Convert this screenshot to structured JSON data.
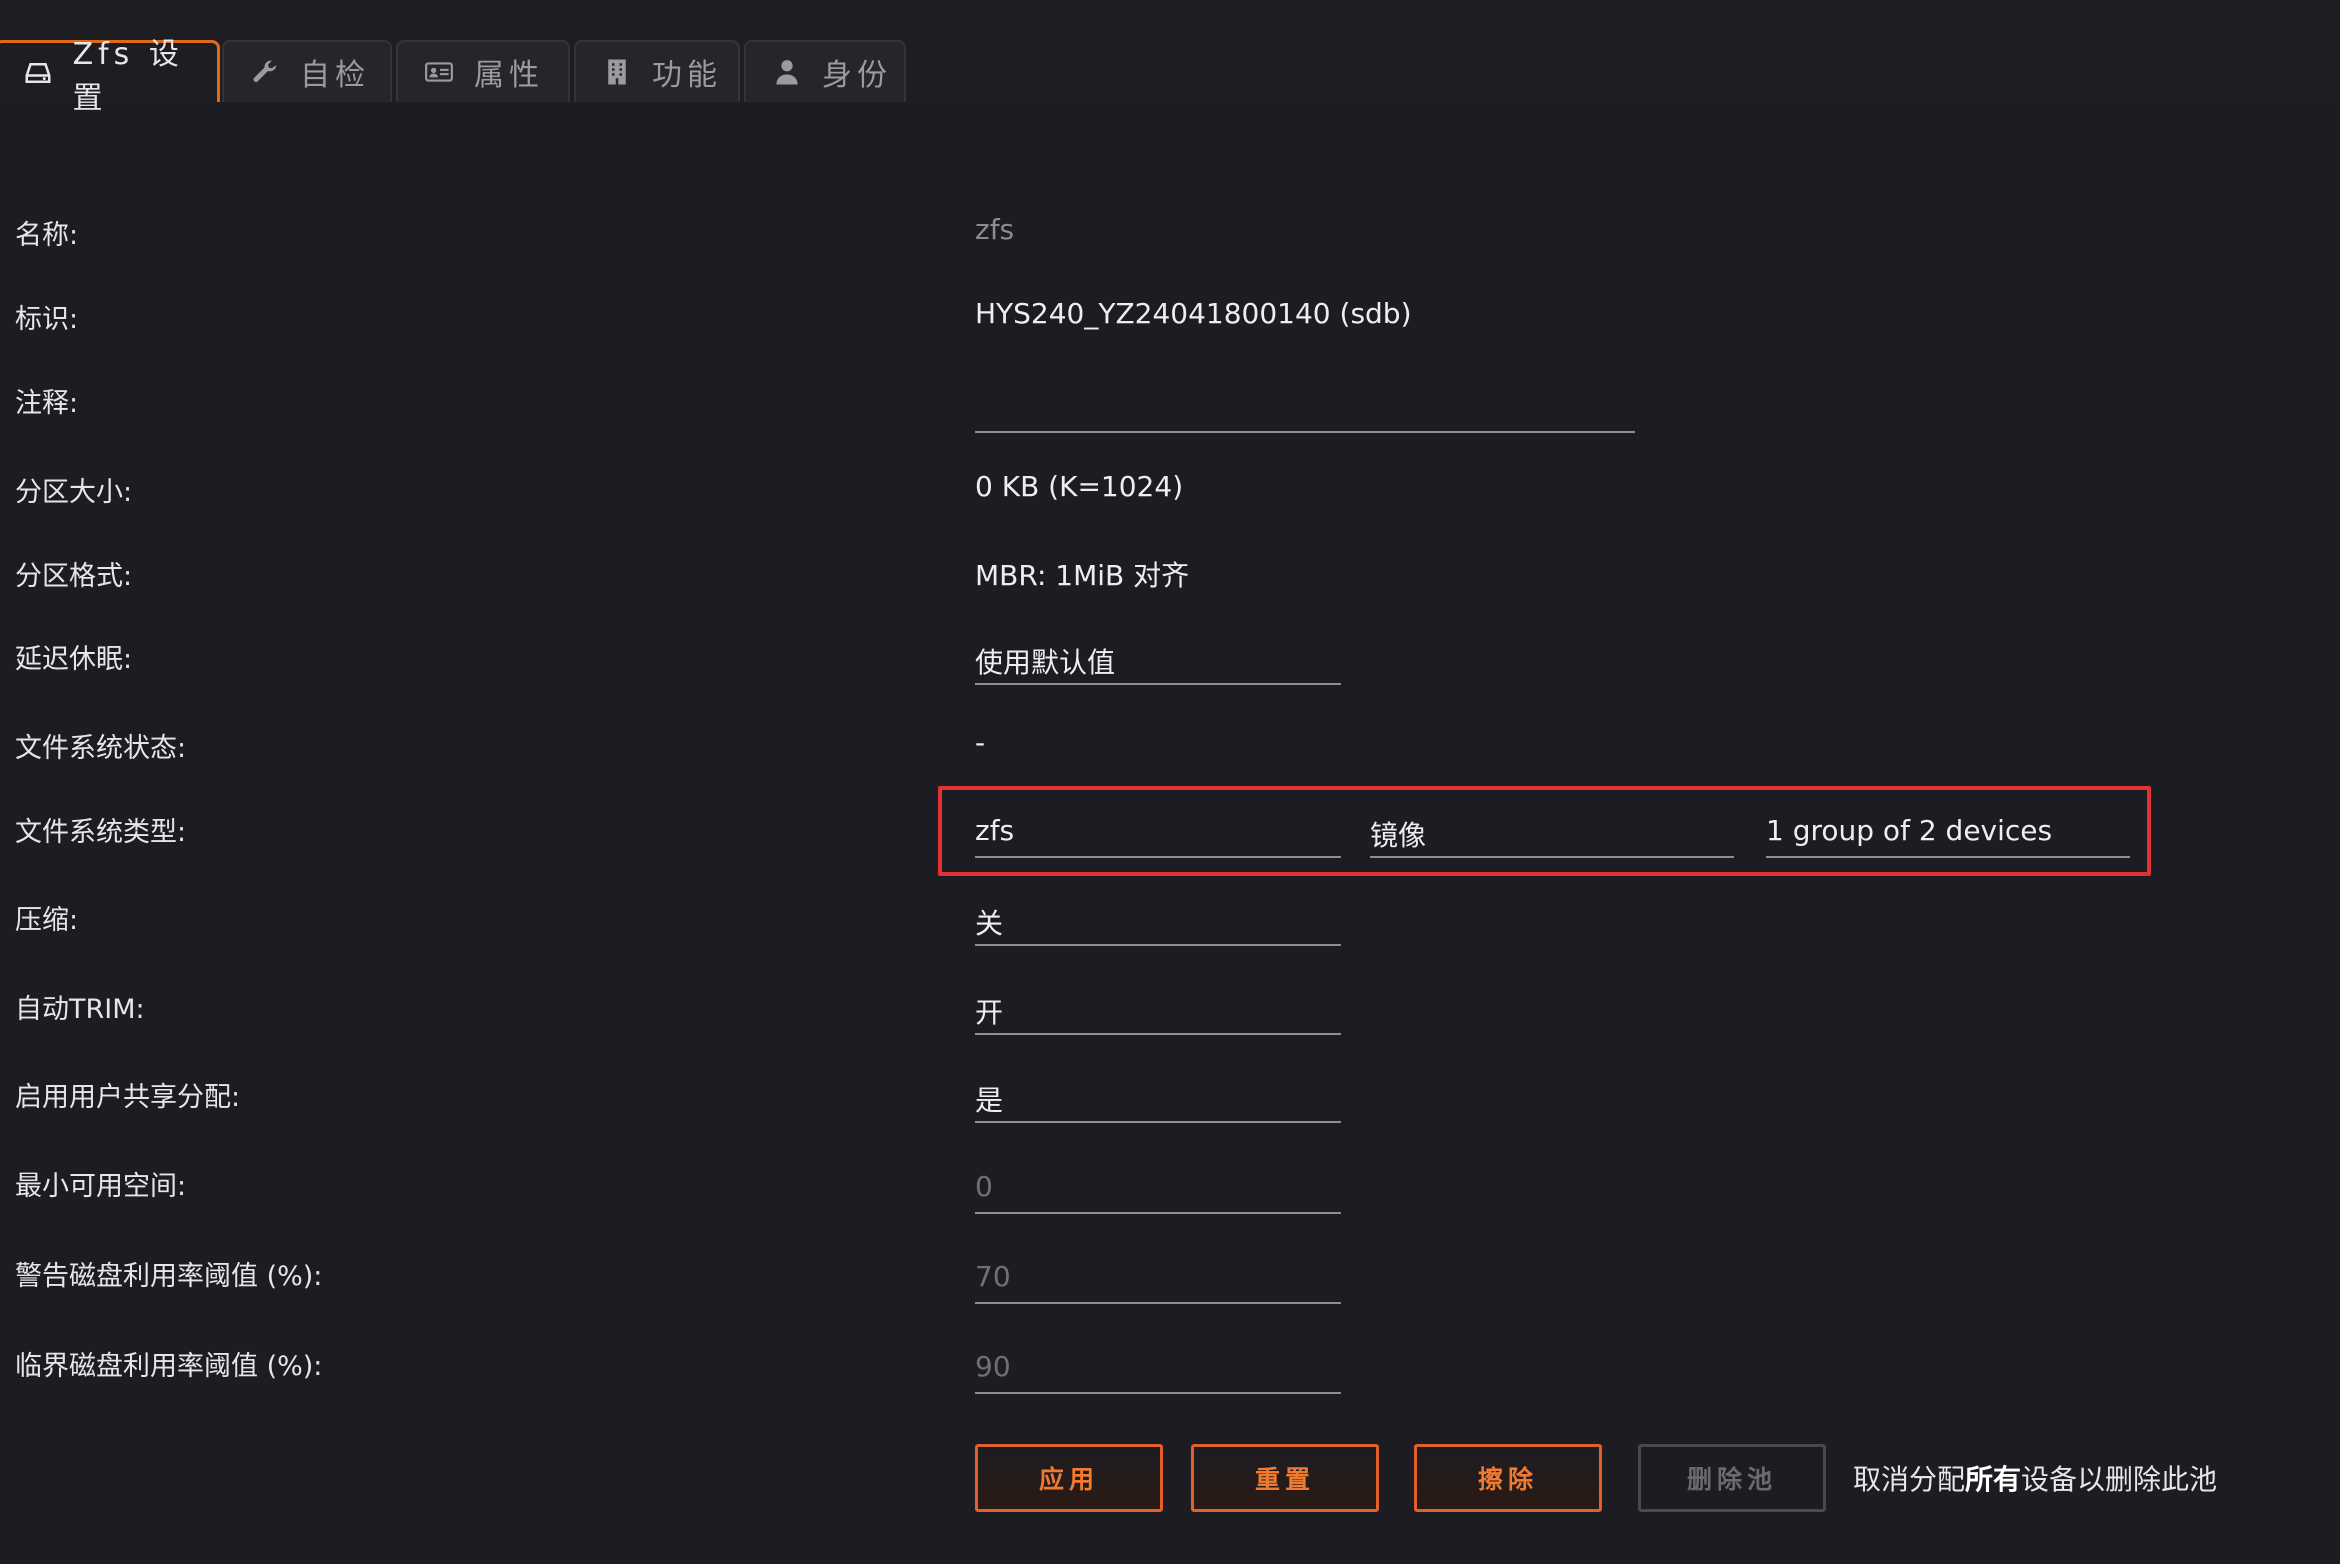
{
  "tabs": [
    {
      "label": "Zfs 设置",
      "icon": "drive-icon",
      "active": true
    },
    {
      "label": "自检",
      "icon": "wrench-icon"
    },
    {
      "label": "属性",
      "icon": "id-card-icon"
    },
    {
      "label": "功能",
      "icon": "building-icon"
    },
    {
      "label": "身份",
      "icon": "user-icon"
    }
  ],
  "fields": {
    "name": {
      "label": "名称:",
      "value": "zfs"
    },
    "identifier": {
      "label": "标识:",
      "value": "HYS240_YZ24041800140 (sdb)"
    },
    "comment": {
      "label": "注释:",
      "value": ""
    },
    "partition_size": {
      "label": "分区大小:",
      "value": "0 KB (K=1024)"
    },
    "partition_format": {
      "label": "分区格式:",
      "value": "MBR: 1MiB 对齐"
    },
    "spin_down": {
      "label": "延迟休眠:",
      "value": "使用默认值"
    },
    "fs_status": {
      "label": "文件系统状态:",
      "value": "-"
    },
    "fs_type": {
      "label": "文件系统类型:",
      "value": "zfs",
      "profile": "镜像",
      "groups": "1 group of 2 devices"
    },
    "compression": {
      "label": "压缩:",
      "value": "关"
    },
    "autotrim": {
      "label": "自动TRIM:",
      "value": "开"
    },
    "user_share": {
      "label": "启用用户共享分配:",
      "value": "是"
    },
    "min_free": {
      "label": "最小可用空间:",
      "placeholder": "0"
    },
    "warning_threshold": {
      "label": "警告磁盘利用率阈值 (%):",
      "placeholder": "70"
    },
    "critical_threshold": {
      "label": "临界磁盘利用率阈值 (%):",
      "placeholder": "90"
    }
  },
  "buttons": {
    "apply": "应用",
    "reset": "重置",
    "erase": "擦除",
    "delete_pool": "删除池"
  },
  "note": {
    "prefix": "取消分配",
    "bold": "所有",
    "suffix": "设备以删除此池"
  },
  "colors": {
    "accent": "#e2602a",
    "highlight": "#e23232",
    "background": "#1d1c22"
  }
}
